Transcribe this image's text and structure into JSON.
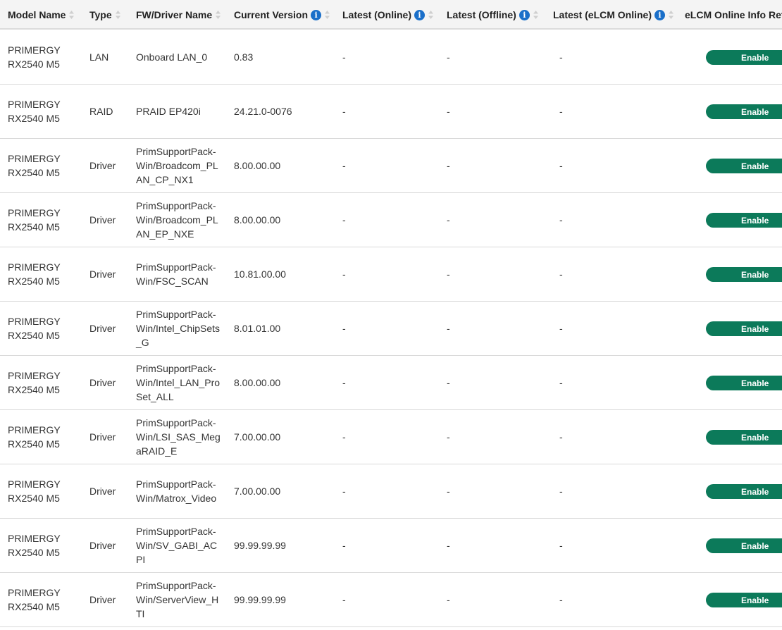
{
  "table": {
    "columns": [
      {
        "label": "Model Name",
        "info": false
      },
      {
        "label": "Type",
        "info": false
      },
      {
        "label": "FW/Driver Name",
        "info": false
      },
      {
        "label": "Current Version",
        "info": true
      },
      {
        "label": "Latest (Online)",
        "info": true
      },
      {
        "label": "Latest (Offline)",
        "info": true
      },
      {
        "label": "Latest (eLCM Online)",
        "info": true
      },
      {
        "label": "eLCM Online Info Retr",
        "info": false
      }
    ],
    "rows": [
      {
        "model": "PRIMERGY RX2540 M5",
        "type": "LAN",
        "fw": "Onboard LAN_0",
        "current": "0.83",
        "latest_online": "-",
        "latest_offline": "-",
        "latest_elcm": "-",
        "elcm_button": "Enable"
      },
      {
        "model": "PRIMERGY RX2540 M5",
        "type": "RAID",
        "fw": "PRAID EP420i",
        "current": "24.21.0-0076",
        "latest_online": "-",
        "latest_offline": "-",
        "latest_elcm": "-",
        "elcm_button": "Enable"
      },
      {
        "model": "PRIMERGY RX2540 M5",
        "type": "Driver",
        "fw": "PrimSupportPack-Win/Broadcom_PLAN_CP_NX1",
        "current": "8.00.00.00",
        "latest_online": "-",
        "latest_offline": "-",
        "latest_elcm": "-",
        "elcm_button": "Enable"
      },
      {
        "model": "PRIMERGY RX2540 M5",
        "type": "Driver",
        "fw": "PrimSupportPack-Win/Broadcom_PLAN_EP_NXE",
        "current": "8.00.00.00",
        "latest_online": "-",
        "latest_offline": "-",
        "latest_elcm": "-",
        "elcm_button": "Enable"
      },
      {
        "model": "PRIMERGY RX2540 M5",
        "type": "Driver",
        "fw": "PrimSupportPack-Win/FSC_SCAN",
        "current": "10.81.00.00",
        "latest_online": "-",
        "latest_offline": "-",
        "latest_elcm": "-",
        "elcm_button": "Enable"
      },
      {
        "model": "PRIMERGY RX2540 M5",
        "type": "Driver",
        "fw": "PrimSupportPack-Win/Intel_ChipSets_G",
        "current": "8.01.01.00",
        "latest_online": "-",
        "latest_offline": "-",
        "latest_elcm": "-",
        "elcm_button": "Enable"
      },
      {
        "model": "PRIMERGY RX2540 M5",
        "type": "Driver",
        "fw": "PrimSupportPack-Win/Intel_LAN_ProSet_ALL",
        "current": "8.00.00.00",
        "latest_online": "-",
        "latest_offline": "-",
        "latest_elcm": "-",
        "elcm_button": "Enable"
      },
      {
        "model": "PRIMERGY RX2540 M5",
        "type": "Driver",
        "fw": "PrimSupportPack-Win/LSI_SAS_MegaRAID_E",
        "current": "7.00.00.00",
        "latest_online": "-",
        "latest_offline": "-",
        "latest_elcm": "-",
        "elcm_button": "Enable"
      },
      {
        "model": "PRIMERGY RX2540 M5",
        "type": "Driver",
        "fw": "PrimSupportPack-Win/Matrox_Video",
        "current": "7.00.00.00",
        "latest_online": "-",
        "latest_offline": "-",
        "latest_elcm": "-",
        "elcm_button": "Enable"
      },
      {
        "model": "PRIMERGY RX2540 M5",
        "type": "Driver",
        "fw": "PrimSupportPack-Win/SV_GABI_ACPI",
        "current": "99.99.99.99",
        "latest_online": "-",
        "latest_offline": "-",
        "latest_elcm": "-",
        "elcm_button": "Enable"
      },
      {
        "model": "PRIMERGY RX2540 M5",
        "type": "Driver",
        "fw": "PrimSupportPack-Win/ServerView_HTI",
        "current": "99.99.99.99",
        "latest_online": "-",
        "latest_offline": "-",
        "latest_elcm": "-",
        "elcm_button": "Enable"
      }
    ]
  },
  "colors": {
    "header_bg": "#f4f4f4",
    "button_green": "#0c7a5a",
    "info_blue": "#1a6fc9",
    "row_border": "#d9d9d9"
  },
  "icons": {
    "sort": "sort-icon",
    "info": "info-icon"
  }
}
